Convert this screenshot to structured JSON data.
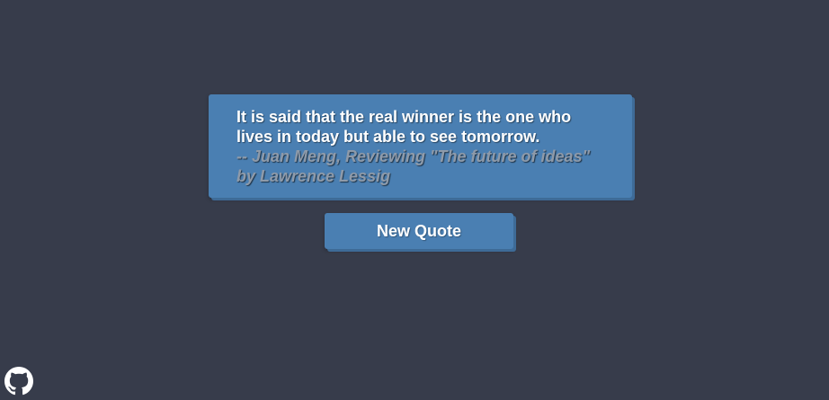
{
  "page": {
    "background": "#373c4b"
  },
  "quote": {
    "text": "It is said that the real winner is the one who lives in today but able to see tomorrow.",
    "author": "-- Juan Meng, Reviewing \"The future of ideas\" by Lawrence Lessig",
    "card_color": "#4a7fb2",
    "author_color": "#8e9aa9"
  },
  "actions": {
    "new_quote_label": "New Quote"
  },
  "footer": {
    "github_icon": "github-icon"
  }
}
